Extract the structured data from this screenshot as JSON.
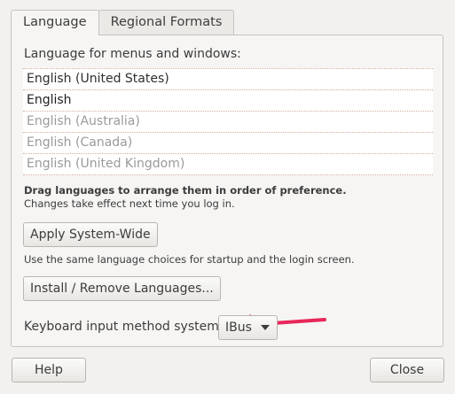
{
  "tabs": [
    {
      "label": "Language",
      "active": true
    },
    {
      "label": "Regional Formats",
      "active": false
    }
  ],
  "language_section": {
    "heading": "Language for menus and windows:",
    "languages": [
      {
        "label": "English (United States)",
        "state": "active"
      },
      {
        "label": "English",
        "state": "english"
      },
      {
        "label": "English (Australia)",
        "state": "inactive"
      },
      {
        "label": "English (Canada)",
        "state": "inactive"
      },
      {
        "label": "English (United Kingdom)",
        "state": "inactive"
      }
    ],
    "hint_bold": "Drag languages to arrange them in order of preference.",
    "hint_normal": "Changes take effect next time you log in."
  },
  "apply_button": {
    "label": "Apply System-Wide",
    "description": "Use the same language choices for startup and the login screen."
  },
  "install_button": {
    "label": "Install / Remove Languages..."
  },
  "keyboard": {
    "label": "Keyboard input method system:",
    "selected": "IBus"
  },
  "footer": {
    "help_label": "Help",
    "close_label": "Close"
  },
  "colors": {
    "annotation_arrow": "#e8265a",
    "background": "#f2f1f0"
  }
}
